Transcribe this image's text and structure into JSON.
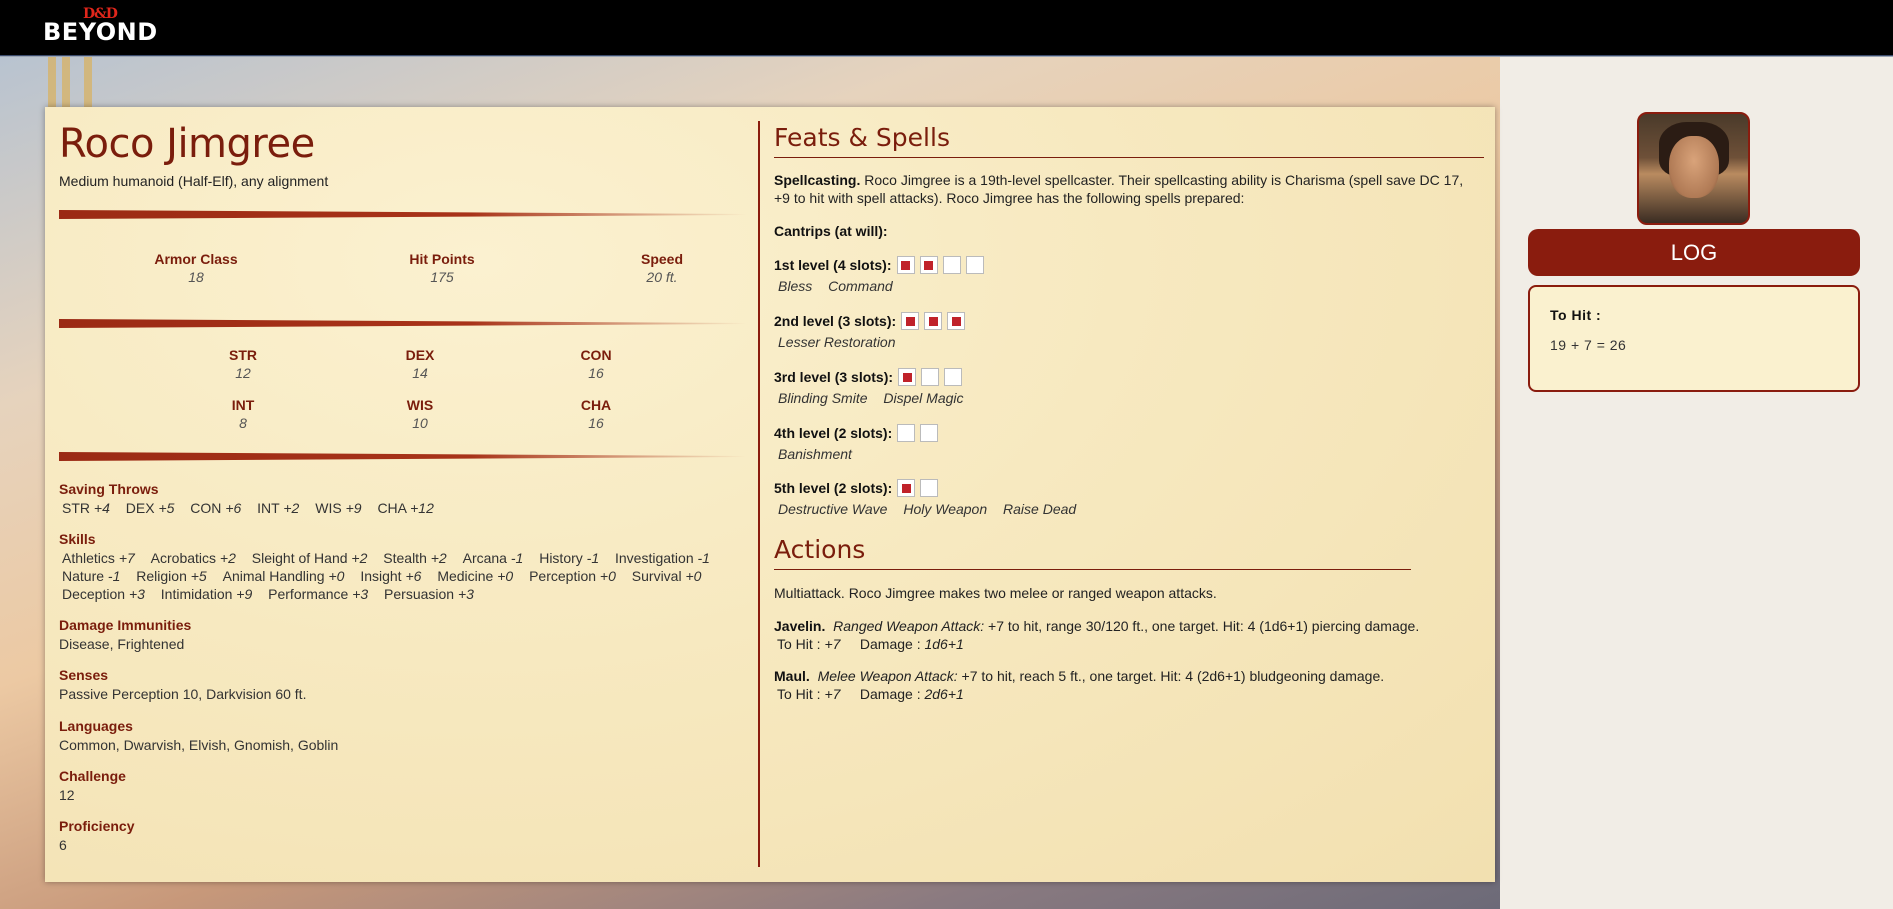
{
  "brand": {
    "top": "D&D",
    "bottom": "BEYOND"
  },
  "character": {
    "name": "Roco Jimgree",
    "subtitle": "Medium humanoid (Half-Elf), any alignment",
    "core_stats": [
      {
        "label": "Armor Class",
        "value": "18"
      },
      {
        "label": "Hit Points",
        "value": "175"
      },
      {
        "label": "Speed",
        "value": "20 ft."
      }
    ],
    "abilities": [
      {
        "label": "STR",
        "value": "12"
      },
      {
        "label": "DEX",
        "value": "14"
      },
      {
        "label": "CON",
        "value": "16"
      },
      {
        "label": "INT",
        "value": "8"
      },
      {
        "label": "WIS",
        "value": "10"
      },
      {
        "label": "CHA",
        "value": "16"
      }
    ],
    "saving_throws": {
      "title": "Saving Throws",
      "items": [
        {
          "name": "STR",
          "mod": "+4"
        },
        {
          "name": "DEX",
          "mod": "+5"
        },
        {
          "name": "CON",
          "mod": "+6"
        },
        {
          "name": "INT",
          "mod": "+2"
        },
        {
          "name": "WIS",
          "mod": "+9"
        },
        {
          "name": "CHA",
          "mod": "+12"
        }
      ]
    },
    "skills": {
      "title": "Skills",
      "rows": [
        [
          {
            "name": "Athletics",
            "mod": "+7"
          },
          {
            "name": "Acrobatics",
            "mod": "+2"
          },
          {
            "name": "Sleight of Hand",
            "mod": "+2"
          },
          {
            "name": "Stealth",
            "mod": "+2"
          },
          {
            "name": "Arcana",
            "mod": "-1"
          },
          {
            "name": "History",
            "mod": "-1"
          },
          {
            "name": "Investigation",
            "mod": "-1"
          }
        ],
        [
          {
            "name": "Nature",
            "mod": "-1"
          },
          {
            "name": "Religion",
            "mod": "+5"
          },
          {
            "name": "Animal Handling",
            "mod": "+0"
          },
          {
            "name": "Insight",
            "mod": "+6"
          },
          {
            "name": "Medicine",
            "mod": "+0"
          },
          {
            "name": "Perception",
            "mod": "+0"
          },
          {
            "name": "Survival",
            "mod": "+0"
          }
        ],
        [
          {
            "name": "Deception",
            "mod": "+3"
          },
          {
            "name": "Intimidation",
            "mod": "+9"
          },
          {
            "name": "Performance",
            "mod": "+3"
          },
          {
            "name": "Persuasion",
            "mod": "+3"
          }
        ]
      ]
    },
    "damage_immunities": {
      "title": "Damage Immunities",
      "text": "Disease, Frightened"
    },
    "senses": {
      "title": "Senses",
      "text": "Passive Perception 10, Darkvision 60 ft."
    },
    "languages": {
      "title": "Languages",
      "text": "Common, Dwarvish, Elvish, Gnomish, Goblin"
    },
    "challenge": {
      "title": "Challenge",
      "text": "12"
    },
    "proficiency": {
      "title": "Proficiency",
      "text": "6"
    }
  },
  "feats_spells": {
    "title": "Feats & Spells",
    "spellcasting_label": "Spellcasting.",
    "spellcasting_text": "Roco Jimgree is a 19th-level spellcaster. Their spellcasting ability is Charisma (spell save DC 17, +9 to hit with spell attacks). Roco Jimgree has the following spells prepared:",
    "cantrips_label": "Cantrips (at will):",
    "levels": [
      {
        "label": "1st level (4 slots):",
        "slots": [
          true,
          true,
          false,
          false
        ],
        "spells": [
          "Bless",
          "Command"
        ]
      },
      {
        "label": "2nd level (3 slots):",
        "slots": [
          true,
          true,
          true
        ],
        "spells": [
          "Lesser Restoration"
        ]
      },
      {
        "label": "3rd level (3 slots):",
        "slots": [
          true,
          false,
          false
        ],
        "spells": [
          "Blinding Smite",
          "Dispel Magic"
        ]
      },
      {
        "label": "4th level (2 slots):",
        "slots": [
          false,
          false
        ],
        "spells": [
          "Banishment"
        ]
      },
      {
        "label": "5th level (2 slots):",
        "slots": [
          true,
          false
        ],
        "spells": [
          "Destructive Wave",
          "Holy Weapon",
          "Raise Dead"
        ]
      }
    ]
  },
  "actions": {
    "title": "Actions",
    "multiattack": "Multiattack.  Roco Jimgree makes two melee or ranged weapon attacks.",
    "items": [
      {
        "name": "Javelin.",
        "type": "Ranged Weapon Attack:",
        "desc": "+7 to hit, range 30/120 ft., one target. Hit: 4 (1d6+1) piercing damage.",
        "to_hit_label": "To Hit :",
        "to_hit": "+7",
        "damage_label": "Damage :",
        "damage": "1d6+1"
      },
      {
        "name": "Maul.",
        "type": "Melee Weapon Attack:",
        "desc": "+7 to hit, reach 5 ft., one target. Hit: 4 (2d6+1) bludgeoning damage.",
        "to_hit_label": "To Hit :",
        "to_hit": "+7",
        "damage_label": "Damage :",
        "damage": "2d6+1"
      }
    ]
  },
  "log": {
    "button_label": "LOG",
    "title": "To Hit :",
    "line": "19 + 7 = 26"
  }
}
